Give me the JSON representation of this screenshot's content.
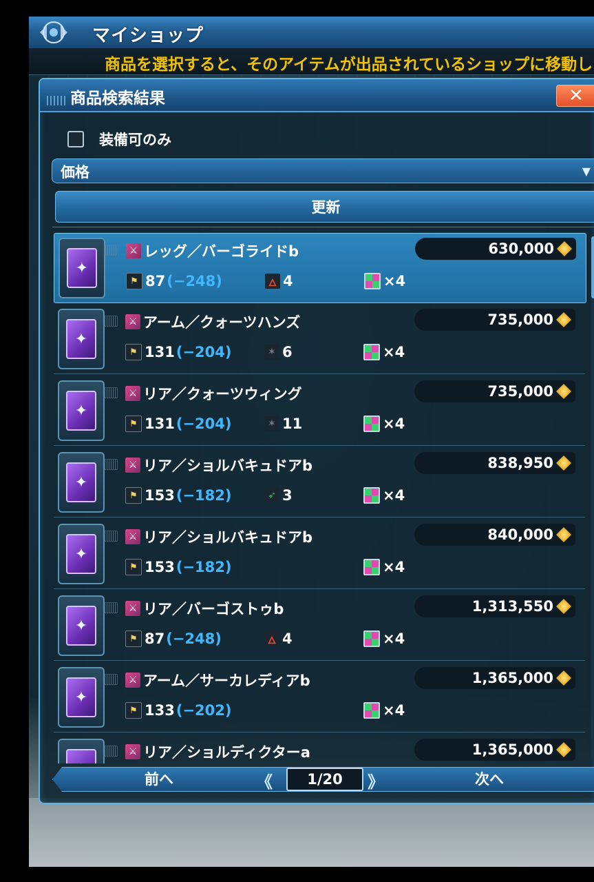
{
  "header": {
    "title": "マイショップ",
    "emblem_icon": "shop-emblem-icon"
  },
  "notice": {
    "text": "商品を選択すると、そのアイテムが出品されているショップに移動し"
  },
  "panel": {
    "title": "商品検索結果",
    "close_label": "✕",
    "filter_label": "装備可のみ",
    "filter_checked": false,
    "sort_label": "価格",
    "update_label": "更新"
  },
  "items": [
    {
      "name": "レッグ／バーゴライドb",
      "price": "630,000",
      "req": "87",
      "diff": "(−248)",
      "elem": "4",
      "elem_icon": "fire-icon",
      "slots": "×4",
      "selected": true
    },
    {
      "name": "アーム／クォーツハンズ",
      "price": "735,000",
      "req": "131",
      "diff": "(−204)",
      "elem": "6",
      "elem_icon": "dark-icon",
      "slots": "×4",
      "selected": false
    },
    {
      "name": "リア／クォーツウィング",
      "price": "735,000",
      "req": "131",
      "diff": "(−204)",
      "elem": "11",
      "elem_icon": "dark-icon",
      "slots": "×4",
      "selected": false
    },
    {
      "name": "リア／ショルバキュドアb",
      "price": "838,950",
      "req": "153",
      "diff": "(−182)",
      "elem": "3",
      "elem_icon": "wind-icon",
      "slots": "×4",
      "selected": false
    },
    {
      "name": "リア／ショルバキュドアb",
      "price": "840,000",
      "req": "153",
      "diff": "(−182)",
      "elem": "",
      "elem_icon": "",
      "slots": "×4",
      "selected": false
    },
    {
      "name": "リア／バーゴストゥb",
      "price": "1,313,550",
      "req": "87",
      "diff": "(−248)",
      "elem": "4",
      "elem_icon": "fire-icon",
      "slots": "×4",
      "selected": false
    },
    {
      "name": "アーム／サーカレディアb",
      "price": "1,365,000",
      "req": "133",
      "diff": "(−202)",
      "elem": "",
      "elem_icon": "",
      "slots": "×4",
      "selected": false
    },
    {
      "name": "リア／ショルディクターa",
      "price": "1,365,000",
      "req": "",
      "diff": "",
      "elem": "",
      "elem_icon": "",
      "slots": "",
      "selected": false
    }
  ],
  "pager": {
    "prev_label": "前へ",
    "next_label": "次へ",
    "page": "1/20"
  },
  "colors": {
    "accent": "#3a86c4",
    "notice": "#f2c200",
    "diff": "#3fb8ff",
    "close": "#e4502a"
  }
}
